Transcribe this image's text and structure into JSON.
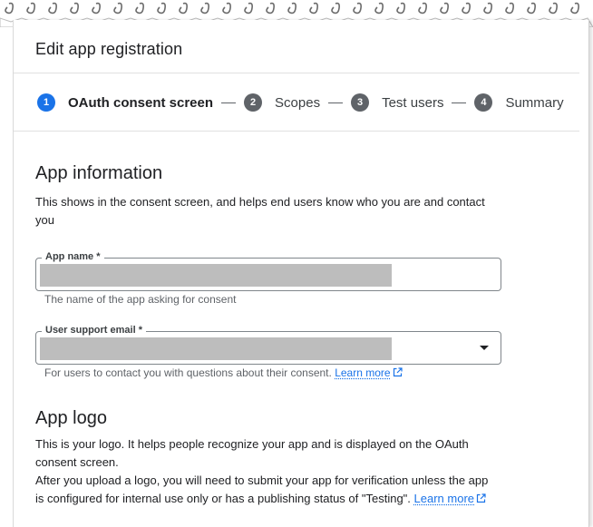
{
  "header": {
    "title": "Edit app registration"
  },
  "stepper": {
    "steps": [
      {
        "number": "1",
        "label": "OAuth consent screen"
      },
      {
        "number": "2",
        "label": "Scopes"
      },
      {
        "number": "3",
        "label": "Test users"
      },
      {
        "number": "4",
        "label": "Summary"
      }
    ],
    "active_step": "1"
  },
  "app_information": {
    "heading": "App information",
    "description": "This shows in the consent screen, and helps end users know who you are and contact you",
    "app_name": {
      "label": "App name *",
      "value": "",
      "hint": "The name of the app asking for consent"
    },
    "user_support_email": {
      "label": "User support email *",
      "value": "",
      "hint": "For users to contact you with questions about their consent.",
      "learn_more": "Learn more"
    }
  },
  "app_logo": {
    "heading": "App logo",
    "line1": "This is your logo. It helps people recognize your app and is displayed on the OAuth consent screen.",
    "line2": "After you upload a logo, you will need to submit your app for verification unless the app is configured for internal use only or has a publishing status of \"Testing\".",
    "learn_more": "Learn more"
  },
  "colors": {
    "accent": "#1a73e8",
    "step_inactive": "#5f6368",
    "redaction": "#bdbdbd"
  }
}
